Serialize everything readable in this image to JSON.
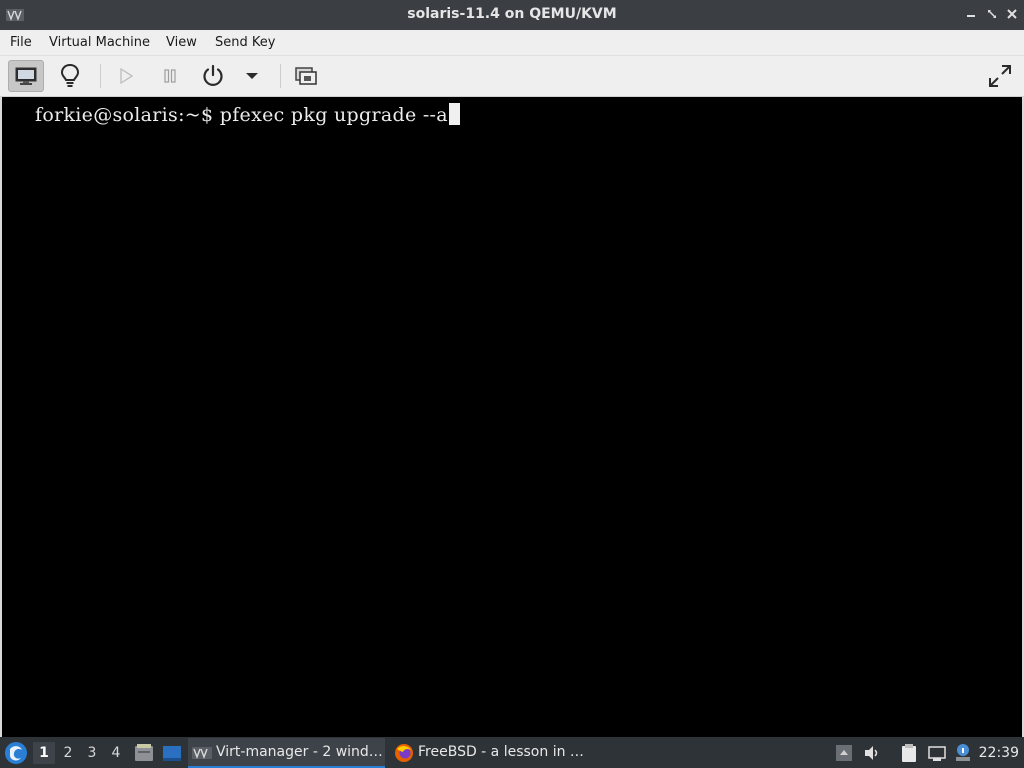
{
  "window": {
    "title": "solaris-11.4 on QEMU/KVM"
  },
  "menubar": {
    "items": [
      "File",
      "Virtual Machine",
      "View",
      "Send Key"
    ]
  },
  "toolbar": {
    "buttons": [
      "console-icon",
      "details-lightbulb-icon",
      "run-icon",
      "pause-icon",
      "power-icon",
      "power-menu-chevron-icon",
      "snapshots-icon",
      "fullscreen-icon"
    ]
  },
  "console": {
    "prompt": "forkie@solaris:~$ ",
    "command": "pfexec pkg upgrade --a"
  },
  "taskbar": {
    "workspaces": [
      "1",
      "2",
      "3",
      "4"
    ],
    "active_workspace": "1",
    "tasks": [
      {
        "label": "Virt-manager - 2 wind…",
        "icon": "virt-manager-icon"
      },
      {
        "label": "FreeBSD - a lesson in …",
        "icon": "firefox-icon"
      }
    ],
    "clock": "22:39"
  },
  "colors": {
    "titlebar": "#3b3f44",
    "menubar": "#efefef",
    "console_bg": "#000000",
    "taskbar": "#2e3338",
    "accent": "#2a7fd4"
  }
}
